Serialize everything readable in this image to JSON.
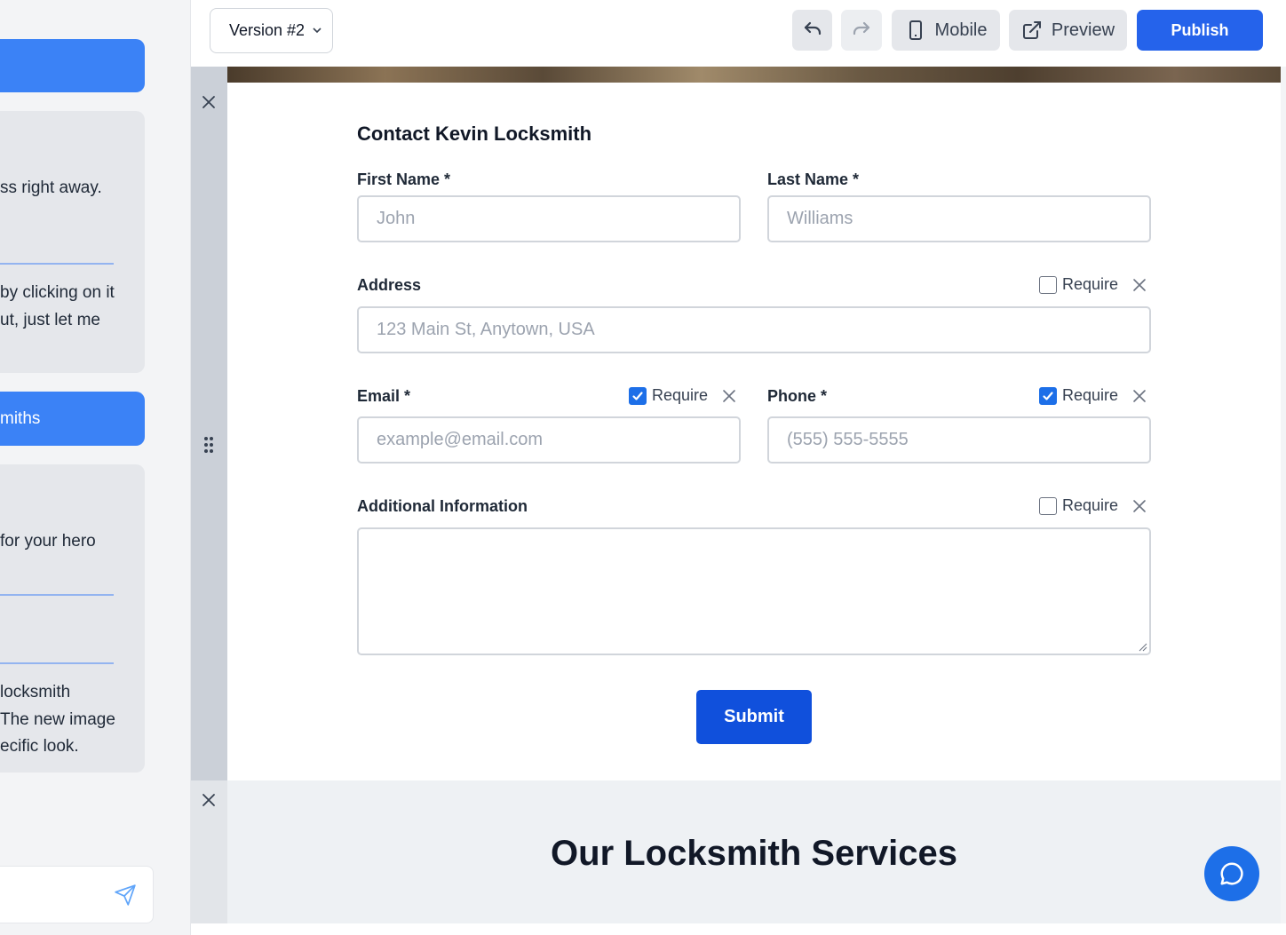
{
  "chat": {
    "messages": [
      {
        "role": "ai",
        "lines": [
          "ss right away."
        ]
      },
      {
        "role": "ai",
        "lines": [
          "by clicking on it",
          "ut, just let me"
        ]
      },
      {
        "role": "user",
        "text": "miths"
      },
      {
        "role": "ai",
        "lines": [
          "for your hero"
        ]
      },
      {
        "role": "ai",
        "lines": [
          "locksmith",
          "The new image",
          "ecific look."
        ]
      }
    ],
    "input_placeholder": ""
  },
  "toolbar": {
    "version_label": "Version #2",
    "mobile_label": "Mobile",
    "preview_label": "Preview",
    "publish_label": "Publish"
  },
  "form": {
    "title": "Contact Kevin Locksmith",
    "first_name": {
      "label": "First Name *",
      "placeholder": "John"
    },
    "last_name": {
      "label": "Last Name *",
      "placeholder": "Williams"
    },
    "address": {
      "label": "Address",
      "placeholder": "123 Main St, Anytown, USA",
      "required": false
    },
    "email": {
      "label": "Email *",
      "placeholder": "example@email.com",
      "required": true
    },
    "phone": {
      "label": "Phone *",
      "placeholder": "(555) 555-5555",
      "required": true
    },
    "additional": {
      "label": "Additional Information",
      "required": false
    },
    "require_label": "Require",
    "submit_label": "Submit"
  },
  "services": {
    "title": "Our Locksmith Services"
  },
  "colors": {
    "accent": "#2563eb",
    "submit": "#1050dc",
    "user_bubble": "#3b82f6"
  }
}
